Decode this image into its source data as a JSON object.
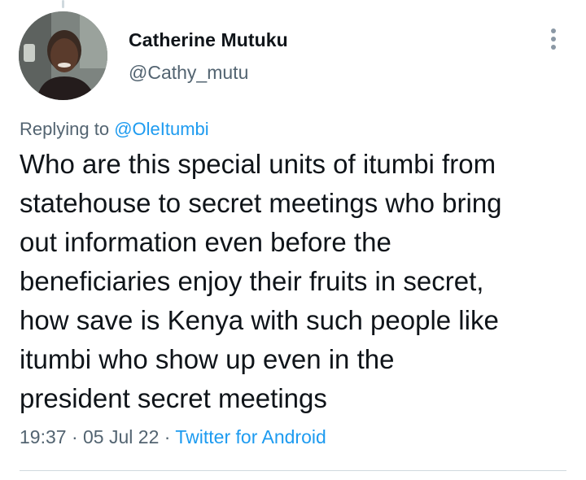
{
  "tweet": {
    "author": {
      "name": "Catherine Mutuku",
      "handle": "@Cathy_mutu"
    },
    "reply_context": {
      "prefix": "Replying to ",
      "mention": "@OleItumbi"
    },
    "text": "Who are this special units of itumbi from\nstatehouse to secret meetings who bring\nout information even before the\nbeneficiaries enjoy their fruits in secret,\nhow save is Kenya with such people like\nitumbi who show up even in the\npresident secret meetings",
    "time": "19:37",
    "separator": " · ",
    "date": "05 Jul 22",
    "source": "Twitter for Android"
  },
  "colors": {
    "text_primary": "#0f1419",
    "text_secondary": "#536471",
    "link": "#1d9bf0",
    "divider": "#cfd9de"
  },
  "icons": {
    "more": "more-vertical-icon"
  }
}
